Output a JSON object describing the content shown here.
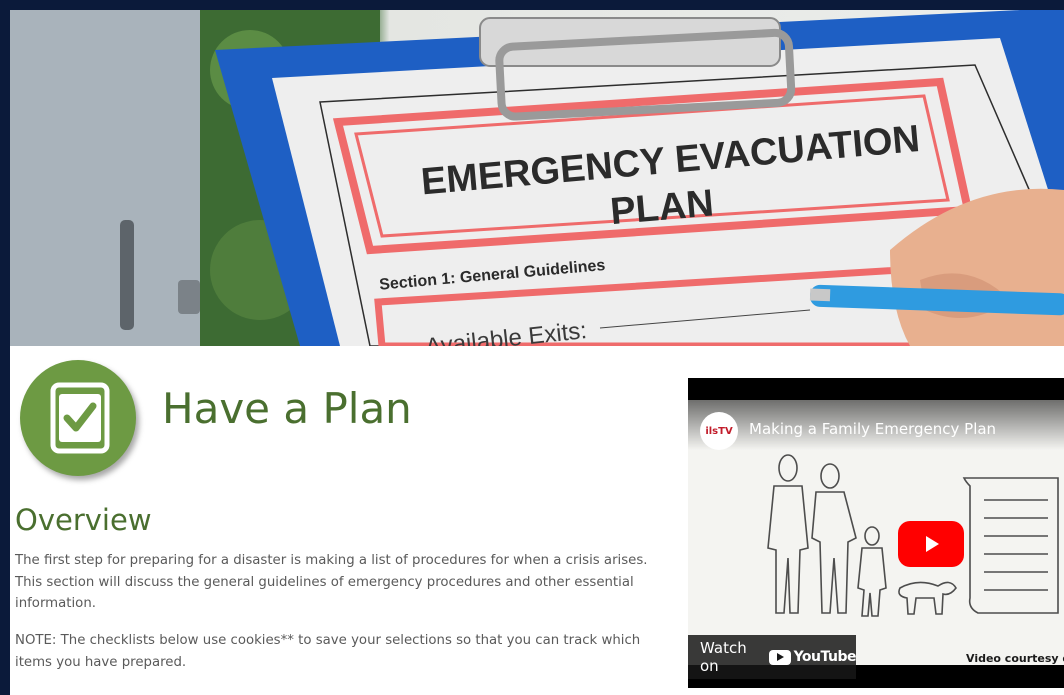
{
  "hero": {
    "clipboard_title_line1": "EMERGENCY EVACUATION",
    "clipboard_title_line2": "PLAN",
    "section_label": "Section 1: General Guidelines",
    "exits_label": "Available Exits:"
  },
  "intro": {
    "title": "Have a Plan",
    "icon": "checkbox-icon",
    "accent_color": "#6d9a43",
    "title_color": "#4a6f2f"
  },
  "overview": {
    "heading": "Overview",
    "paragraph1": "The first step for preparing for a disaster is making a list of procedures for when a crisis arises. This section will discuss the general guidelines of emergency procedures and other essential information.",
    "paragraph2": "NOTE: The checklists below use cookies** to save your selections so that you can track which items you have prepared."
  },
  "video": {
    "channel_logo": "ilsTV",
    "title": "Making a Family Emergency Plan",
    "watch_label": "Watch on",
    "platform": "YouTube",
    "credit": "Video courtesy of"
  }
}
